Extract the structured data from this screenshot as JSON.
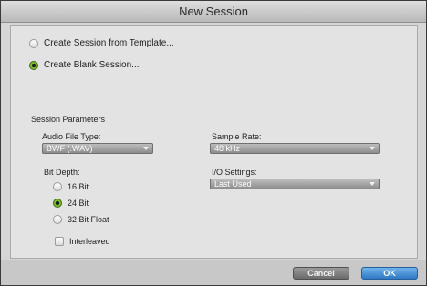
{
  "window": {
    "title": "New Session"
  },
  "session_source": {
    "options": [
      {
        "label": "Create Session from Template...",
        "selected": false
      },
      {
        "label": "Create Blank Session...",
        "selected": true
      }
    ]
  },
  "parameters": {
    "section_label": "Session Parameters",
    "audio_file_type": {
      "label": "Audio File Type:",
      "value": "BWF (.WAV)"
    },
    "sample_rate": {
      "label": "Sample Rate:",
      "value": "48 kHz"
    },
    "bit_depth": {
      "label": "Bit Depth:",
      "options": [
        {
          "label": "16 Bit",
          "selected": false
        },
        {
          "label": "24 Bit",
          "selected": true
        },
        {
          "label": "32 Bit Float",
          "selected": false
        }
      ]
    },
    "io_settings": {
      "label": "I/O Settings:",
      "value": "Last Used"
    },
    "interleaved": {
      "label": "Interleaved",
      "checked": false
    }
  },
  "footer": {
    "cancel_label": "Cancel",
    "ok_label": "OK"
  },
  "colors": {
    "accent_green": "#8fd32a",
    "ok_blue": "#2f78c3"
  }
}
